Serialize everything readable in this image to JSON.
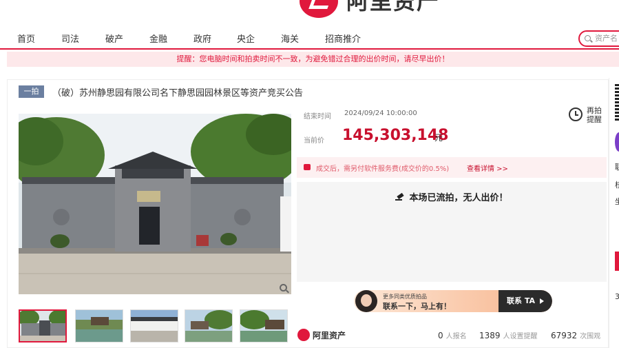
{
  "header": {
    "logo_text": "阿里资产"
  },
  "nav": {
    "items": [
      "首页",
      "司法",
      "破产",
      "金融",
      "政府",
      "央企",
      "海关",
      "招商推介"
    ],
    "search_placeholder": "资产名"
  },
  "notice": "提醒：您电脑时间和拍卖时间不一致，为避免错过合理的出价时间，请尽早出价！",
  "auction": {
    "badge": "一拍",
    "title": "（破）苏州静思园有限公司名下静思园园林景区等资产竞买公告",
    "end_label": "结束时间",
    "end_time": "2024/09/24 10:00:00",
    "price_label": "当前价",
    "price": "145,303,148",
    "price_unit": "元",
    "remind_label": "再拍提醒",
    "fee_text": "成交后，需另付软件服务费(成交价的0.5%)",
    "fee_link": "查看详情 >>",
    "status": "本场已流拍，无人出价！"
  },
  "cs_banner": {
    "small": "更多同类优质拍品",
    "big": "联系一下，马上有！",
    "button": "联系 TA"
  },
  "footer": {
    "logo_text": "阿里资产",
    "signups": "0",
    "signups_label": "人报名",
    "reminders": "1389",
    "reminders_label": "人设置提醒",
    "views": "67932",
    "views_label": "次围观"
  },
  "right_panel": {
    "texts": [
      "联",
      "核",
      "坐",
      "3"
    ]
  },
  "colors": {
    "brand": "#e0183c",
    "price": "#c8102e",
    "badge": "#6b7fa0"
  },
  "icons": [
    "search-icon",
    "clock-icon",
    "gavel-icon",
    "magnifier-icon",
    "fee-icon",
    "play-arrow-icon"
  ]
}
